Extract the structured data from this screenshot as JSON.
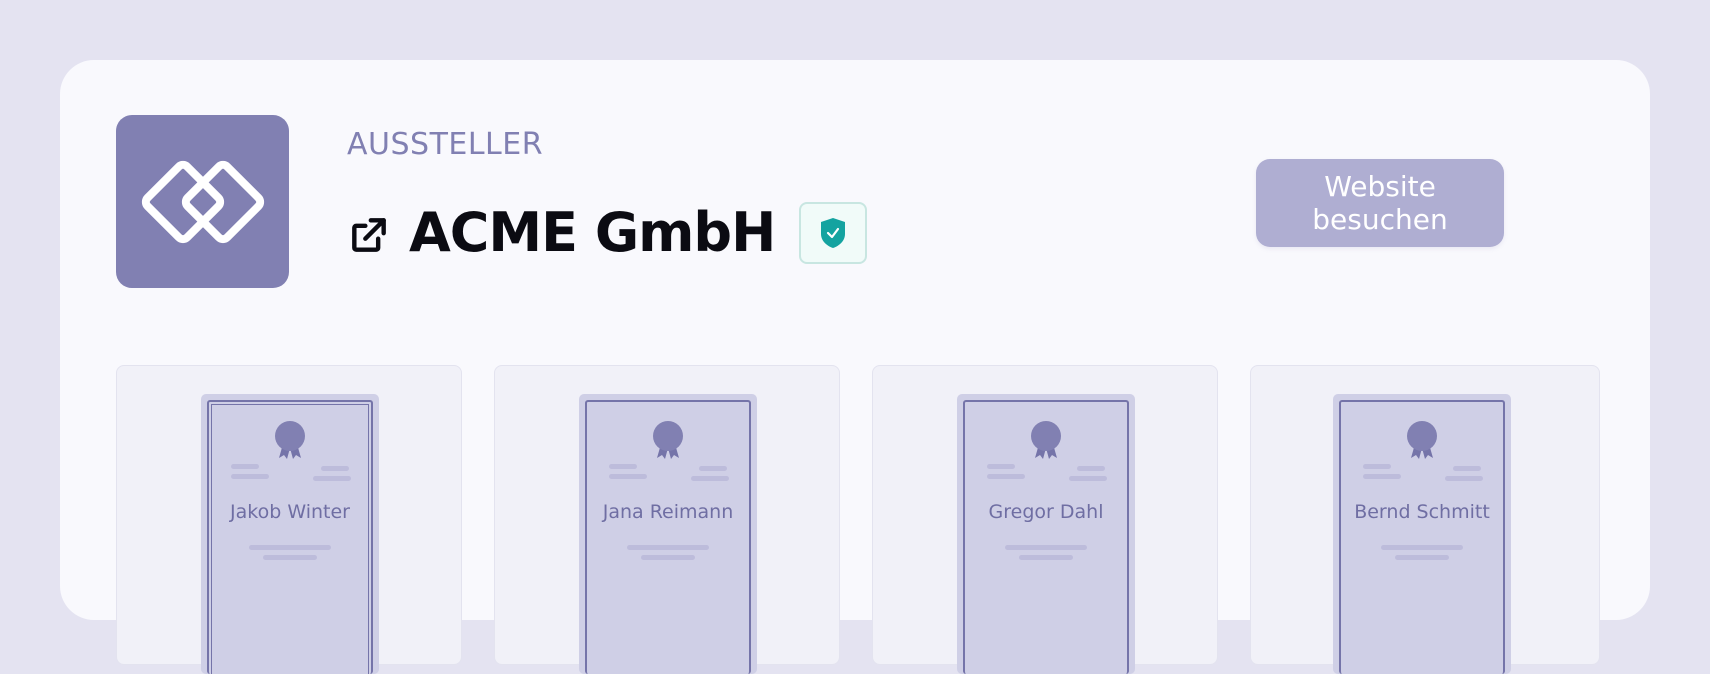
{
  "issuer": {
    "eyebrow": "AUSSTELLER",
    "name": "ACME GmbH",
    "logo_icon": "interlocked-diamonds-logo",
    "verified_icon": "shield-check-icon",
    "external_icon": "external-link-icon",
    "website_button_label": "Website besuchen"
  },
  "colors": {
    "background": "#e4e3f1",
    "card": "#f9f9fd",
    "accent": "#8180b2",
    "button": "#afaed2",
    "verified": "#14a3a0"
  },
  "certificates": [
    {
      "name": "Jakob Winter"
    },
    {
      "name": "Jana Reimann"
    },
    {
      "name": "Gregor Dahl"
    },
    {
      "name": "Bernd Schmitt"
    }
  ]
}
